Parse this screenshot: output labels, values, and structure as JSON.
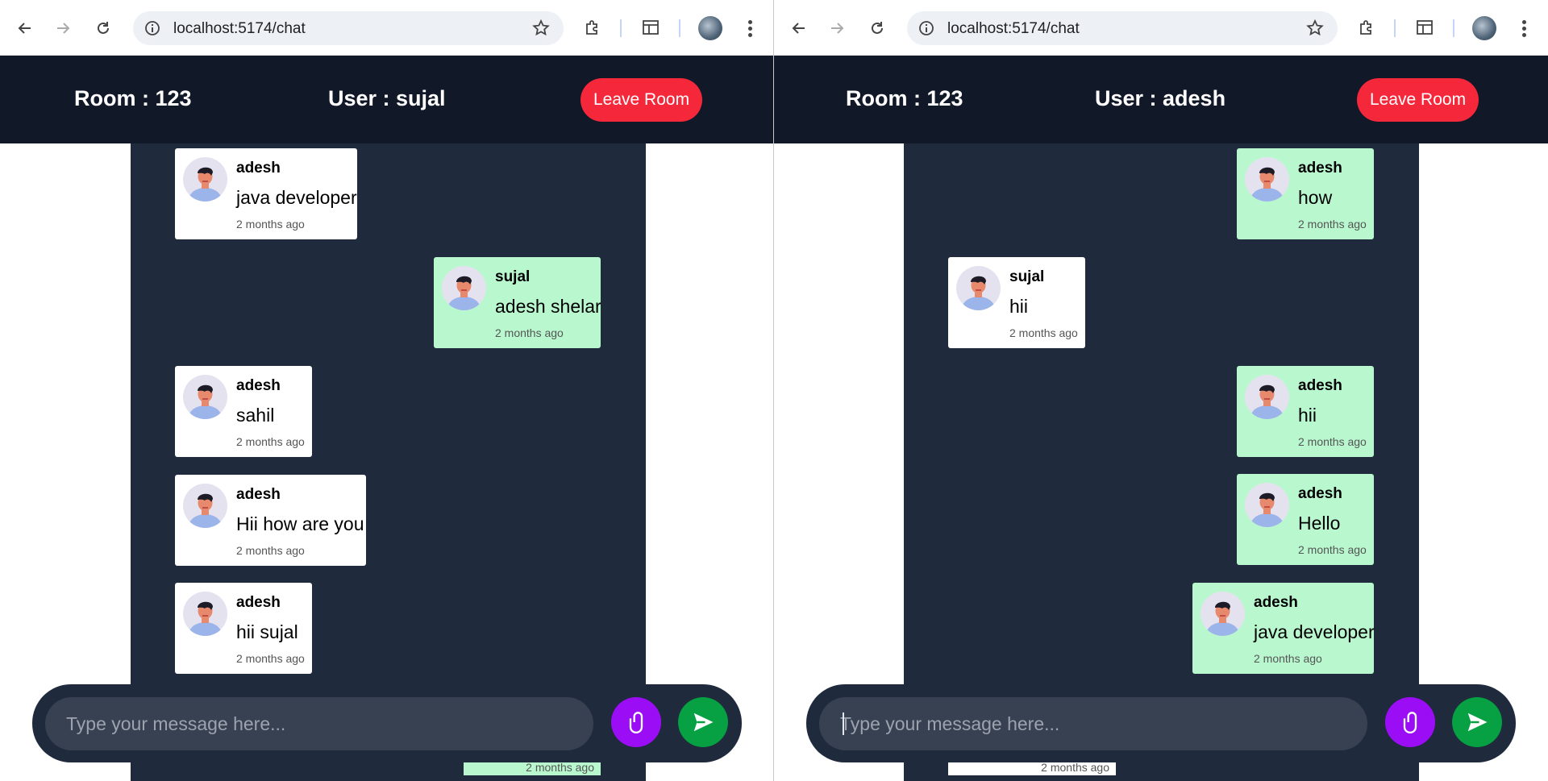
{
  "browser": {
    "url": "localhost:5174/chat"
  },
  "colors": {
    "header_bg": "#111827",
    "chat_bg": "#1f2a3c",
    "leave_button": "#f4283a",
    "own_message": "#b9f8cf",
    "other_message": "#ffffff",
    "attach_button": "#9b0ef5",
    "send_button": "#07a042",
    "input_bg": "#374151"
  },
  "left": {
    "header": {
      "room": "Room : 123",
      "user": "User : sujal",
      "leave_label": "Leave Room"
    },
    "messages": [
      {
        "sender": "adesh",
        "text": "java developer",
        "time": "2 months ago",
        "own": false
      },
      {
        "sender": "sujal",
        "text": "adesh shelar",
        "time": "2 months ago",
        "own": true
      },
      {
        "sender": "adesh",
        "text": "sahil",
        "time": "2 months ago",
        "own": false
      },
      {
        "sender": "adesh",
        "text": "Hii how are you",
        "time": "2 months ago",
        "own": false
      },
      {
        "sender": "adesh",
        "text": "hii sujal",
        "time": "2 months ago",
        "own": false
      }
    ],
    "peek_time": "2 months ago",
    "input": {
      "placeholder": "Type your message here..."
    }
  },
  "right": {
    "header": {
      "room": "Room : 123",
      "user": "User : adesh",
      "leave_label": "Leave Room"
    },
    "messages": [
      {
        "sender": "adesh",
        "text": "how",
        "time": "2 months ago",
        "own": true
      },
      {
        "sender": "sujal",
        "text": "hii",
        "time": "2 months ago",
        "own": false
      },
      {
        "sender": "adesh",
        "text": "hii",
        "time": "2 months ago",
        "own": true
      },
      {
        "sender": "adesh",
        "text": "Hello",
        "time": "2 months ago",
        "own": true
      },
      {
        "sender": "adesh",
        "text": "java developer",
        "time": "2 months ago",
        "own": true
      }
    ],
    "peek_time": "2 months ago",
    "input": {
      "placeholder": "Type your message here..."
    }
  },
  "icons": {
    "back": "arrow-left-icon",
    "forward": "arrow-right-icon",
    "reload": "reload-icon",
    "site_info": "info-icon",
    "bookmark": "star-icon",
    "extensions": "puzzle-icon",
    "side_panel": "side-panel-icon",
    "profile": "profile-avatar-icon",
    "menu": "kebab-menu-icon",
    "user_avatar": "user-avatar-icon",
    "attach": "paperclip-icon",
    "send": "send-icon"
  }
}
